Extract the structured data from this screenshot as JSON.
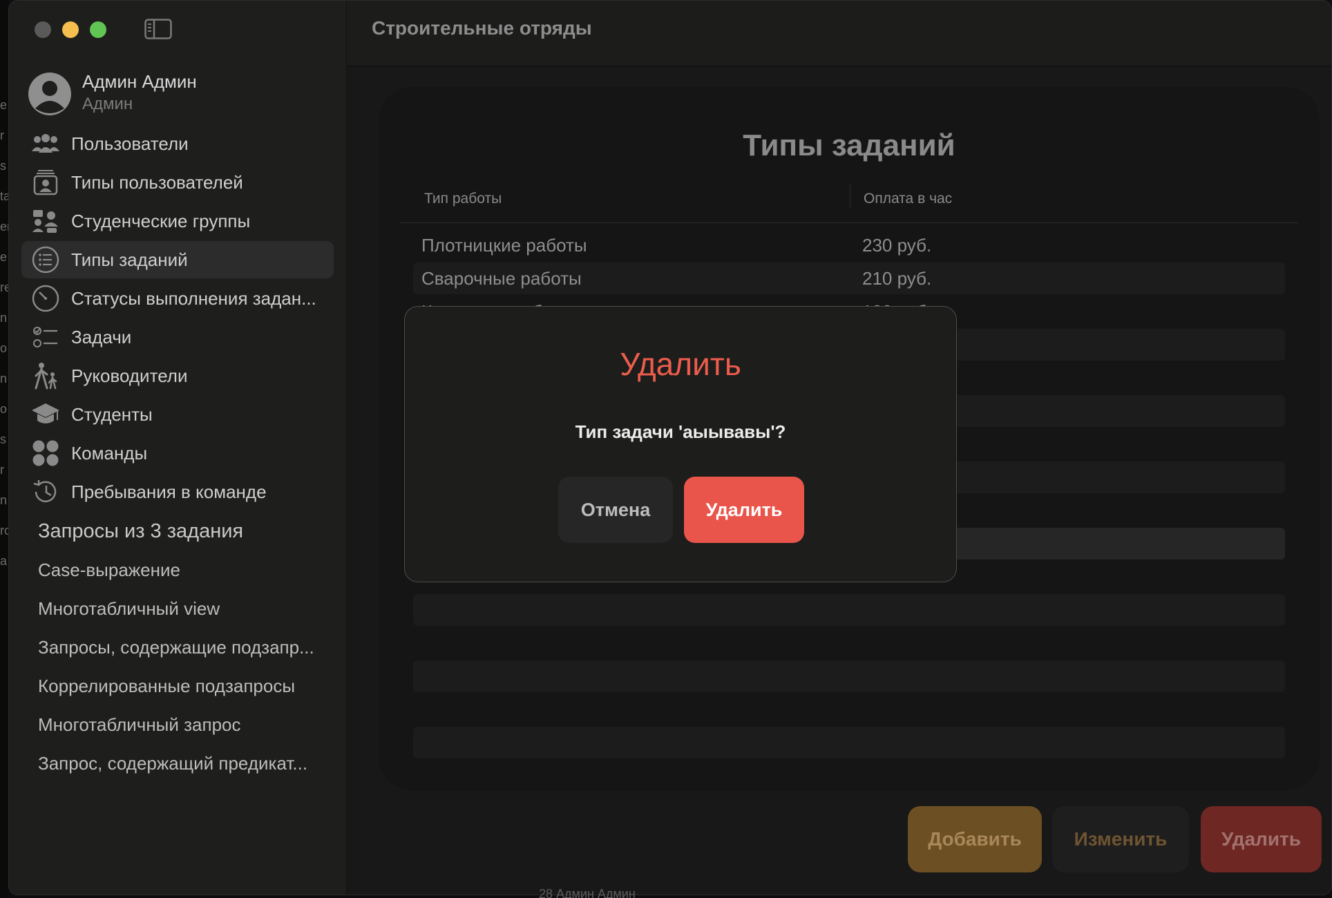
{
  "edge_fragments": [
    "e",
    "r",
    "s",
    "ta",
    "er",
    "e",
    "re",
    "n",
    "o",
    "n",
    "o",
    "s",
    "r",
    "n",
    "ro",
    "a"
  ],
  "under_row_text": "28      Админ              Админ",
  "window": {
    "title": "Строительные отряды"
  },
  "profile": {
    "name": "Админ Админ",
    "role": "Админ"
  },
  "sidebar": {
    "items": [
      {
        "label": "Пользователи",
        "icon": "people-icon"
      },
      {
        "label": "Типы пользователей",
        "icon": "person-badge-icon"
      },
      {
        "label": "Студенческие группы",
        "icon": "group-icon"
      },
      {
        "label": "Типы заданий",
        "icon": "list-circle-icon",
        "active": true
      },
      {
        "label": "Статусы выполнения задан...",
        "icon": "gauge-icon"
      },
      {
        "label": "Задачи",
        "icon": "checklist-icon"
      },
      {
        "label": "Руководители",
        "icon": "figure-walk-icon"
      },
      {
        "label": "Студенты",
        "icon": "graduation-cap-icon"
      },
      {
        "label": "Команды",
        "icon": "circles-grid-icon"
      },
      {
        "label": "Пребывания в команде",
        "icon": "history-icon"
      }
    ],
    "section_title": "Запросы из 3 задания",
    "queries": [
      "Case-выражение",
      "Многотабличный view",
      "Запросы, содержащие подзапр...",
      "Коррелированные подзапросы",
      "Многотабличный запрос",
      "Запрос, содержащий предикат..."
    ]
  },
  "page": {
    "title": "Типы заданий",
    "columns": [
      "Тип работы",
      "Оплата в час"
    ],
    "rows": [
      {
        "type": "Плотницкие работы",
        "pay": "230 руб."
      },
      {
        "type": "Сварочные работы",
        "pay": "210 руб."
      },
      {
        "type": "Каменные работы",
        "pay": "190 руб."
      }
    ]
  },
  "actions": {
    "add": "Добавить",
    "edit": "Изменить",
    "delete": "Удалить"
  },
  "dialog": {
    "title": "Удалить",
    "message": "Тип задачи 'аыывавы'?",
    "cancel": "Отмена",
    "confirm": "Удалить"
  },
  "colors": {
    "accent_red": "#e9554a",
    "accent_orange": "#6c4f22",
    "traffic_min": "#f6be4f",
    "traffic_max": "#61c554"
  }
}
